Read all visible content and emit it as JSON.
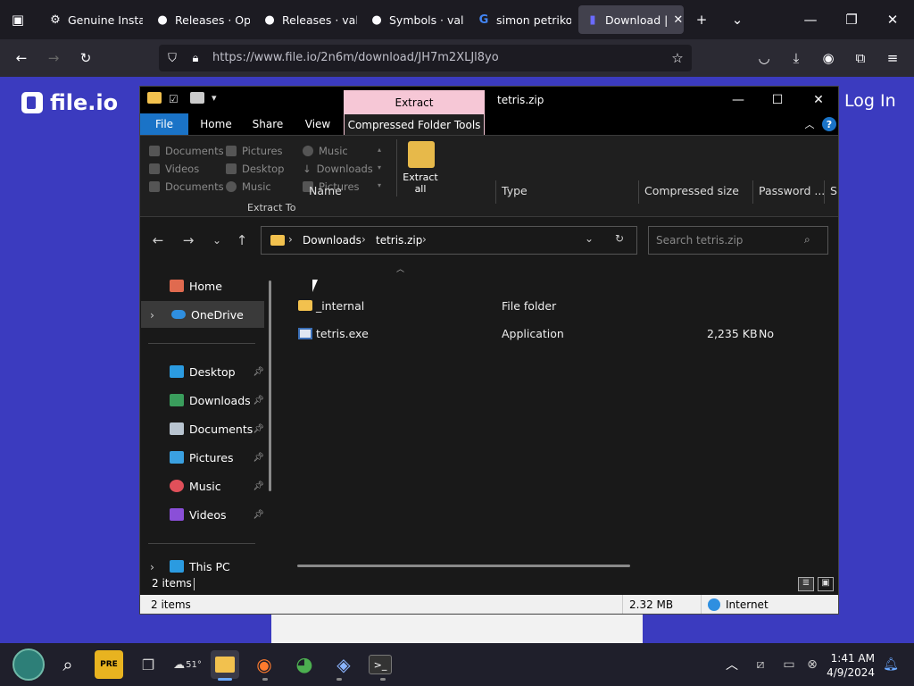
{
  "browser": {
    "tabs": [
      {
        "label": "Genuine Insta",
        "icon": "gear-icon",
        "active": false
      },
      {
        "label": "Releases · Ope",
        "icon": "github-icon",
        "active": false
      },
      {
        "label": "Releases · vali",
        "icon": "github-icon",
        "active": false
      },
      {
        "label": "Symbols · vali",
        "icon": "github-icon",
        "active": false
      },
      {
        "label": "simon petriko",
        "icon": "google-icon",
        "active": false
      },
      {
        "label": "Download |",
        "icon": "fileio-icon",
        "active": true
      }
    ],
    "new_tab_glyph": "+",
    "url": "https://www.file.io/2n6m/download/JH7m2XLJl8yo"
  },
  "page": {
    "logo_text": "file.io",
    "login_label": "Log In"
  },
  "explorer": {
    "title": "tetris.zip",
    "context_tab": "Extract",
    "ribbon_tabs": [
      "File",
      "Home",
      "Share",
      "View",
      "Compressed Folder Tools"
    ],
    "extract_to": [
      [
        "Documents",
        "Pictures",
        "Music"
      ],
      [
        "Videos",
        "Desktop",
        "Downloads"
      ],
      [
        "Documents",
        "Music",
        "Pictures"
      ]
    ],
    "extract_all_label": "Extract all",
    "extract_to_label": "Extract To",
    "breadcrumb": [
      "Downloads",
      "tetris.zip"
    ],
    "search_placeholder": "Search tetris.zip",
    "nav": {
      "home": "Home",
      "onedrive": "OneDrive",
      "quick": [
        "Desktop",
        "Downloads",
        "Documents",
        "Pictures",
        "Music",
        "Videos"
      ],
      "thispc": "This PC"
    },
    "columns": [
      "Name",
      "Type",
      "Compressed size",
      "Password ...",
      "Si"
    ],
    "files": [
      {
        "name": "_internal",
        "type": "File folder",
        "size": "",
        "password": ""
      },
      {
        "name": "tetris.exe",
        "type": "Application",
        "size": "2,235 KB",
        "password": "No"
      }
    ],
    "item_count": "2 items",
    "status": {
      "items": "2 items",
      "size": "2.32 MB",
      "zone": "Internet"
    }
  },
  "taskbar": {
    "weather": "51°",
    "time": "1:41 AM",
    "date": "4/9/2024"
  },
  "colors": {
    "page_bg": "#3b3bbf",
    "extract_tab": "#f6c7d6",
    "ribbon_file": "#1a73c7"
  }
}
